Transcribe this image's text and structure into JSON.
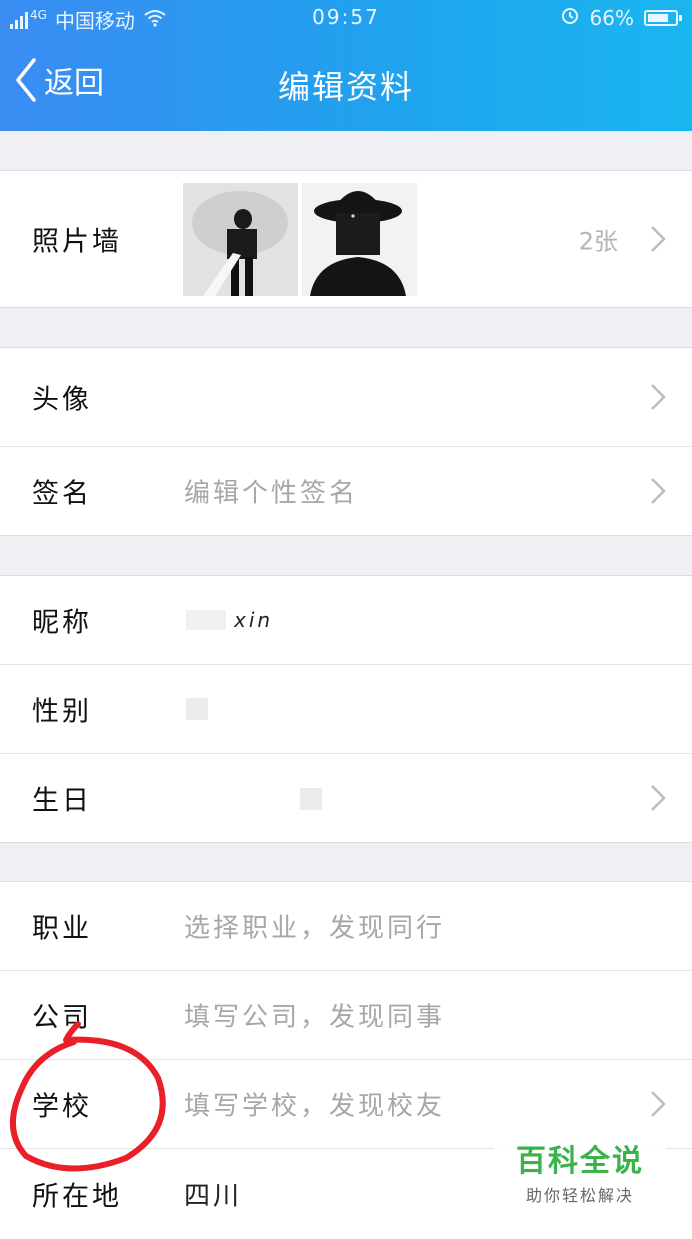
{
  "status_bar": {
    "network": "4G",
    "carrier": "中国移动",
    "time": "09:57",
    "battery": "66%",
    "battery_level": 0.66,
    "icons": [
      "signal-icon",
      "wifi-icon",
      "alarm-icon",
      "battery-icon"
    ]
  },
  "nav": {
    "back_label": "返回",
    "title": "编辑资料"
  },
  "photo_wall": {
    "label": "照片墙",
    "count": "2张"
  },
  "profile": {
    "avatar_label": "头像",
    "signature_label": "签名",
    "signature_placeholder": "编辑个性签名"
  },
  "basic": {
    "nickname_label": "昵称",
    "nickname_value": "xin",
    "gender_label": "性别",
    "birthday_label": "生日"
  },
  "details": {
    "occupation_label": "职业",
    "occupation_placeholder": "选择职业，发现同行",
    "company_label": "公司",
    "company_placeholder": "填写公司，发现同事",
    "school_label": "学校",
    "school_placeholder": "填写学校，发现校友",
    "location_label": "所在地",
    "location_value": "四川"
  },
  "watermark": {
    "title": "百科全说",
    "subtitle": "助你轻松解决"
  },
  "colors": {
    "header_gradient_start": "#3a8cf2",
    "header_gradient_end": "#1ab6f0",
    "annotation_red": "#e8202a",
    "watermark_green": "#3cb24a"
  }
}
